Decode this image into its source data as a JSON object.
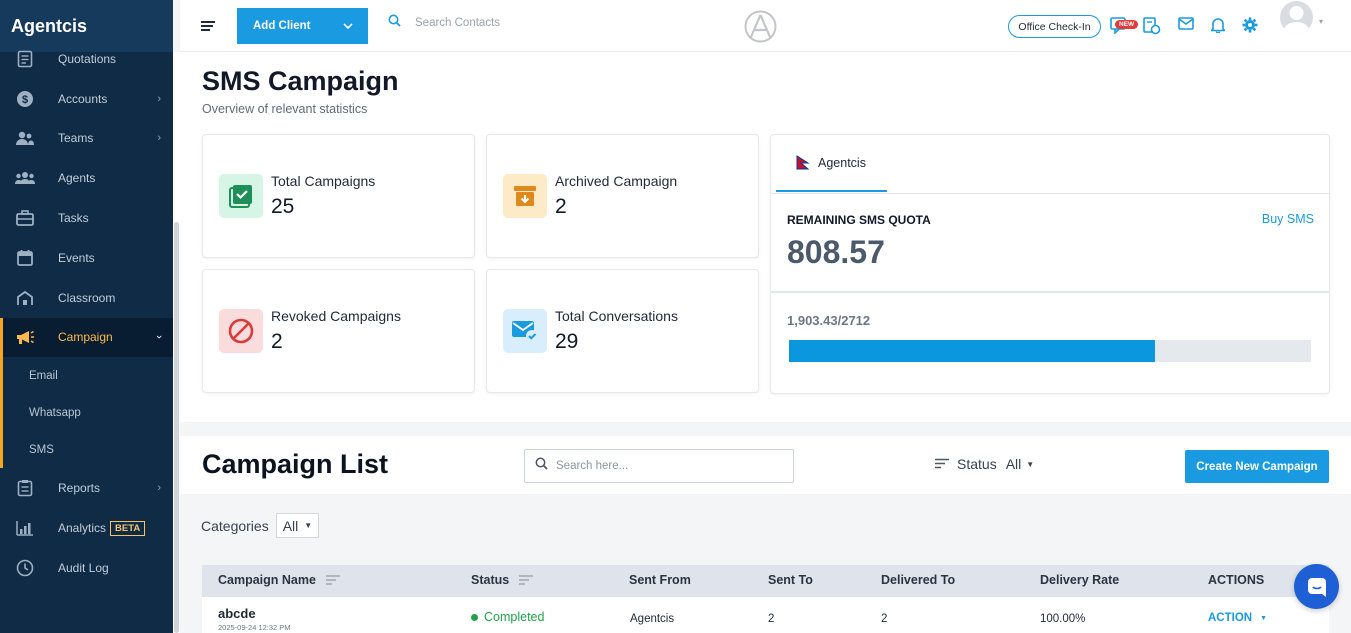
{
  "app": {
    "brand": "Agentcis"
  },
  "sidebar": {
    "items": [
      {
        "label": "Quotations",
        "icon": "document-icon"
      },
      {
        "label": "Accounts",
        "icon": "dollar-icon",
        "chevron": true
      },
      {
        "label": "Teams",
        "icon": "team-icon",
        "chevron": true
      },
      {
        "label": "Agents",
        "icon": "agents-icon"
      },
      {
        "label": "Tasks",
        "icon": "briefcase-icon"
      },
      {
        "label": "Events",
        "icon": "calendar-icon"
      },
      {
        "label": "Classroom",
        "icon": "classroom-icon"
      }
    ],
    "campaign": {
      "label": "Campaign",
      "icon": "megaphone-icon"
    },
    "sub_items": [
      "Email",
      "Whatsapp",
      "SMS"
    ],
    "lower_items": [
      {
        "label": "Reports",
        "icon": "report-icon",
        "chevron": true
      },
      {
        "label": "Analytics",
        "icon": "analytics-icon",
        "badge": "BETA"
      },
      {
        "label": "Audit Log",
        "icon": "audit-icon"
      }
    ]
  },
  "topbar": {
    "add_client": "Add Client",
    "search_placeholder": "Search Contacts",
    "office_checkin": "Office Check-In",
    "new_badge": "NEW"
  },
  "page": {
    "title": "SMS Campaign",
    "subtitle": "Overview of relevant statistics"
  },
  "stats": [
    {
      "label": "Total Campaigns",
      "value": "25",
      "color": "#d6f5e6",
      "accent": "#1f8f5a"
    },
    {
      "label": "Archived Campaign",
      "value": "2",
      "color": "#fdebc8",
      "accent": "#e08a1e"
    },
    {
      "label": "Revoked Campaigns",
      "value": "2",
      "color": "#fbdcdc",
      "accent": "#d93a3a"
    },
    {
      "label": "Total Conversations",
      "value": "29",
      "color": "#d8eefc",
      "accent": "#1a9ae0"
    }
  ],
  "quota": {
    "tab": "Agentcis",
    "heading": "REMAINING SMS QUOTA",
    "buy_link": "Buy SMS",
    "remaining": "808.57",
    "used": "1,903.43/2712",
    "used_fraction": 0.7018
  },
  "list": {
    "title": "Campaign List",
    "search_placeholder": "Search here...",
    "status_label": "Status",
    "status_value": "All",
    "create_button": "Create New Campaign",
    "categories_label": "Categories",
    "categories_value": "All",
    "columns": [
      "Campaign Name",
      "Status",
      "Sent From",
      "Sent To",
      "Delivered To",
      "Delivery Rate",
      "ACTIONS"
    ],
    "rows": [
      {
        "name": "abcde",
        "date": "2025-09-24 12:32 PM",
        "status": "Completed",
        "sent_from": "Agentcis",
        "sent_to": "2",
        "delivered_to": "2",
        "delivery_rate": "100.00%",
        "action": "ACTION"
      }
    ]
  },
  "colors": {
    "primary": "#1a9ae0",
    "sidebar": "#0f2b46",
    "active": "#f5a524",
    "success": "#22a04a"
  }
}
